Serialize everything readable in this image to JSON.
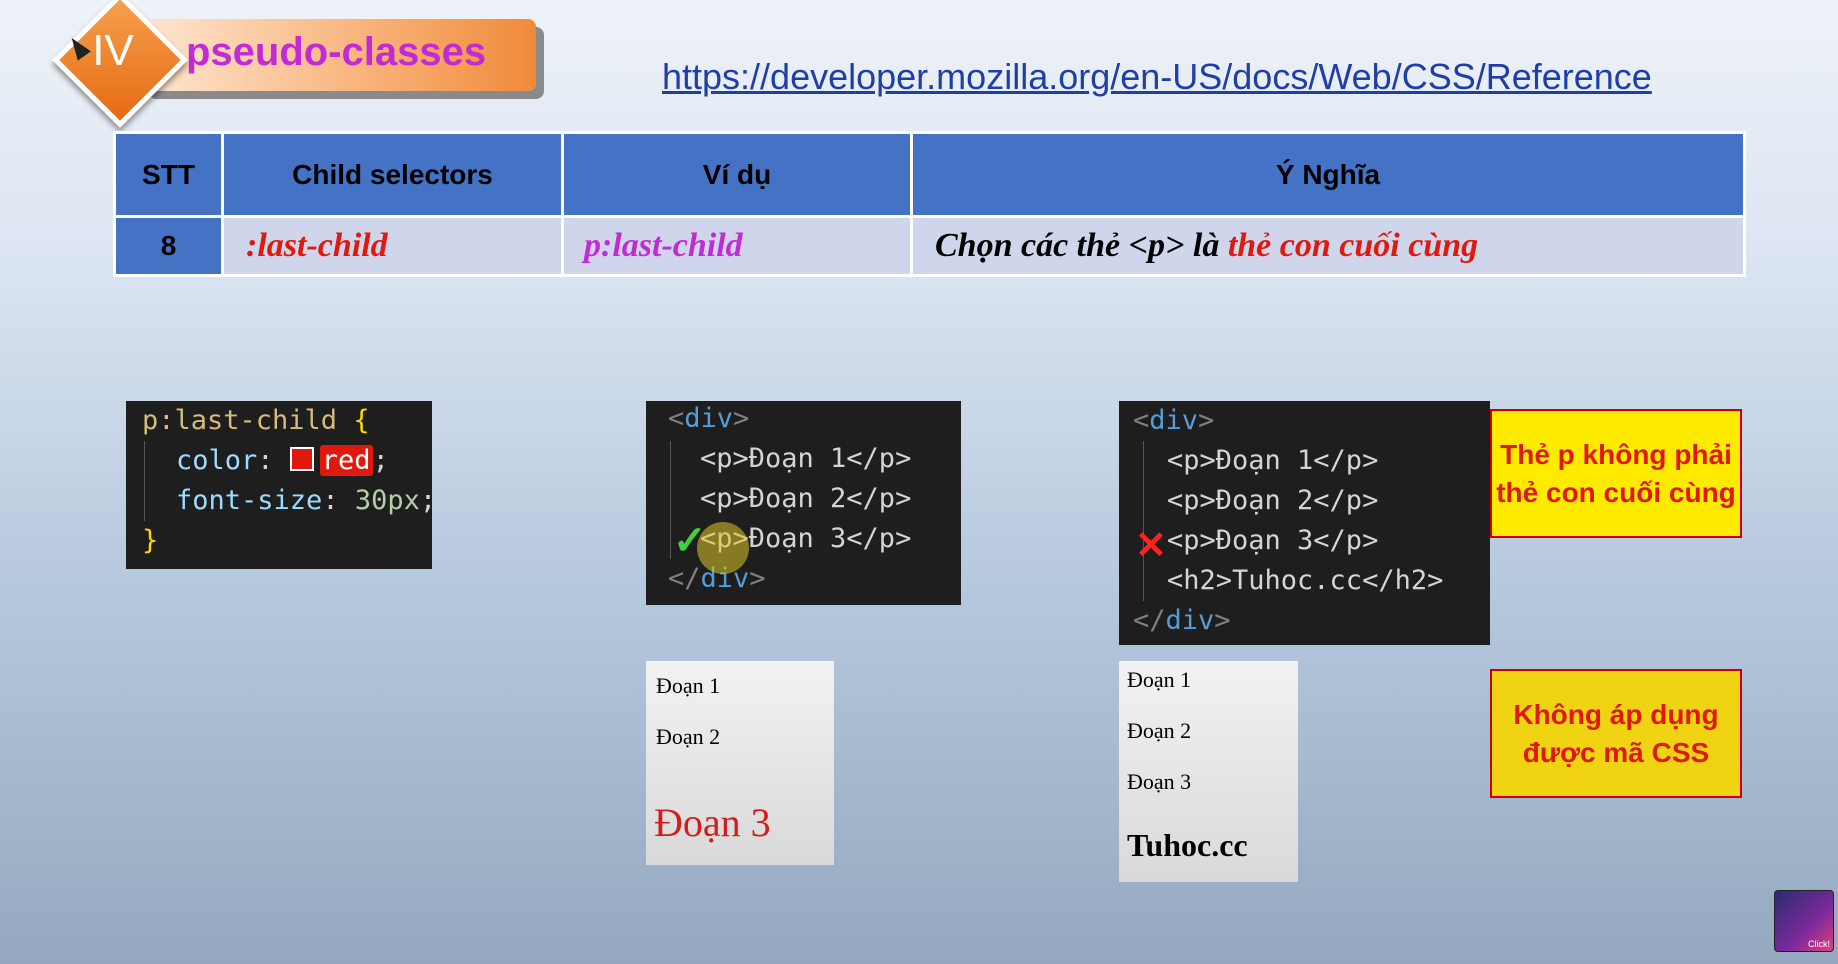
{
  "header": {
    "numeral": "IV",
    "title": "pseudo-classes"
  },
  "reference_url": "https://developer.mozilla.org/en-US/docs/Web/CSS/Reference",
  "table": {
    "headers": [
      "STT",
      "Child selectors",
      "Ví dụ",
      "Ý Nghĩa"
    ],
    "row": {
      "stt": "8",
      "selector": ":last-child",
      "example": "p:last-child",
      "meaning_prefix": "Chọn các thẻ <p> là ",
      "meaning_highlight": "thẻ con cuối cùng"
    }
  },
  "css_code": {
    "selector": "p:last-child",
    "open": "{",
    "prop1": "color",
    "val1": "red",
    "prop2": "font-size",
    "val2": "30px",
    "close": "}"
  },
  "html_code_1": {
    "lines": [
      "<div>",
      "<p>Đoạn 1</p>",
      "<p>Đoạn 2</p>",
      "<p>Đoạn 3</p>",
      "</div>"
    ]
  },
  "html_code_2": {
    "lines": [
      "<div>",
      "<p>Đoạn 1</p>",
      "<p>Đoạn 2</p>",
      "<p>Đoạn 3</p>",
      "<h2>Tuhoc.cc</h2>",
      "</div>"
    ]
  },
  "preview_1": {
    "p1": "Đoạn 1",
    "p2": "Đoạn 2",
    "p3": "Đoạn 3"
  },
  "preview_2": {
    "p1": "Đoạn 1",
    "p2": "Đoạn 2",
    "p3": "Đoạn 3",
    "h2": "Tuhoc.cc"
  },
  "notes": {
    "not_last": "Thẻ p không phải thẻ con cuối cùng",
    "not_applied": "Không áp dụng được mã CSS"
  },
  "avatar_label": "Click!",
  "colors": {
    "accent": "#4472c4",
    "highlight": "#e0190f",
    "purple": "#c22ad6",
    "note_bg": "#ffea00"
  }
}
